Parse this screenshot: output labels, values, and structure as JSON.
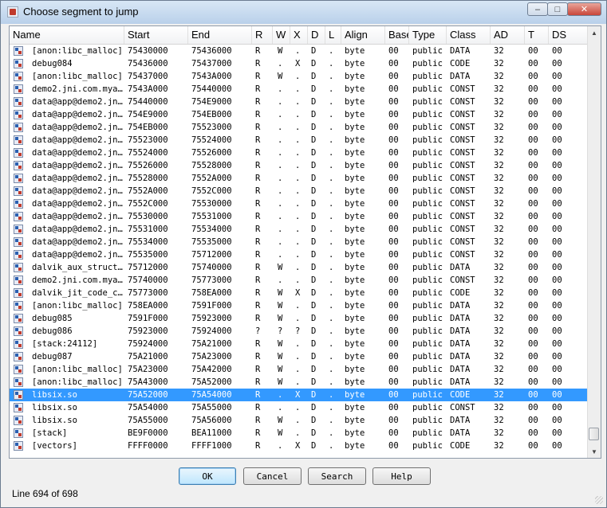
{
  "window": {
    "title": "Choose segment to jump"
  },
  "columns": [
    "Name",
    "Start",
    "End",
    "R",
    "W",
    "X",
    "D",
    "L",
    "Align",
    "Base",
    "Type",
    "Class",
    "AD",
    "T",
    "DS"
  ],
  "rows": [
    [
      "[anon:libc_malloc]",
      "75430000",
      "75436000",
      "R",
      "W",
      ".",
      "D",
      ".",
      "byte",
      "00",
      "public",
      "DATA",
      "32",
      "00",
      "00"
    ],
    [
      "debug084",
      "75436000",
      "75437000",
      "R",
      ".",
      "X",
      "D",
      ".",
      "byte",
      "00",
      "public",
      "CODE",
      "32",
      "00",
      "00"
    ],
    [
      "[anon:libc_malloc]",
      "75437000",
      "7543A000",
      "R",
      "W",
      ".",
      "D",
      ".",
      "byte",
      "00",
      "public",
      "DATA",
      "32",
      "00",
      "00"
    ],
    [
      "demo2.jni.com.mya…",
      "7543A000",
      "75440000",
      "R",
      ".",
      ".",
      "D",
      ".",
      "byte",
      "00",
      "public",
      "CONST",
      "32",
      "00",
      "00"
    ],
    [
      "data@app@demo2.jn…",
      "75440000",
      "754E9000",
      "R",
      ".",
      ".",
      "D",
      ".",
      "byte",
      "00",
      "public",
      "CONST",
      "32",
      "00",
      "00"
    ],
    [
      "data@app@demo2.jn…",
      "754E9000",
      "754EB000",
      "R",
      ".",
      ".",
      "D",
      ".",
      "byte",
      "00",
      "public",
      "CONST",
      "32",
      "00",
      "00"
    ],
    [
      "data@app@demo2.jn…",
      "754EB000",
      "75523000",
      "R",
      ".",
      ".",
      "D",
      ".",
      "byte",
      "00",
      "public",
      "CONST",
      "32",
      "00",
      "00"
    ],
    [
      "data@app@demo2.jn…",
      "75523000",
      "75524000",
      "R",
      ".",
      ".",
      "D",
      ".",
      "byte",
      "00",
      "public",
      "CONST",
      "32",
      "00",
      "00"
    ],
    [
      "data@app@demo2.jn…",
      "75524000",
      "75526000",
      "R",
      ".",
      ".",
      "D",
      ".",
      "byte",
      "00",
      "public",
      "CONST",
      "32",
      "00",
      "00"
    ],
    [
      "data@app@demo2.jn…",
      "75526000",
      "75528000",
      "R",
      ".",
      ".",
      "D",
      ".",
      "byte",
      "00",
      "public",
      "CONST",
      "32",
      "00",
      "00"
    ],
    [
      "data@app@demo2.jn…",
      "75528000",
      "7552A000",
      "R",
      ".",
      ".",
      "D",
      ".",
      "byte",
      "00",
      "public",
      "CONST",
      "32",
      "00",
      "00"
    ],
    [
      "data@app@demo2.jn…",
      "7552A000",
      "7552C000",
      "R",
      ".",
      ".",
      "D",
      ".",
      "byte",
      "00",
      "public",
      "CONST",
      "32",
      "00",
      "00"
    ],
    [
      "data@app@demo2.jn…",
      "7552C000",
      "75530000",
      "R",
      ".",
      ".",
      "D",
      ".",
      "byte",
      "00",
      "public",
      "CONST",
      "32",
      "00",
      "00"
    ],
    [
      "data@app@demo2.jn…",
      "75530000",
      "75531000",
      "R",
      ".",
      ".",
      "D",
      ".",
      "byte",
      "00",
      "public",
      "CONST",
      "32",
      "00",
      "00"
    ],
    [
      "data@app@demo2.jn…",
      "75531000",
      "75534000",
      "R",
      ".",
      ".",
      "D",
      ".",
      "byte",
      "00",
      "public",
      "CONST",
      "32",
      "00",
      "00"
    ],
    [
      "data@app@demo2.jn…",
      "75534000",
      "75535000",
      "R",
      ".",
      ".",
      "D",
      ".",
      "byte",
      "00",
      "public",
      "CONST",
      "32",
      "00",
      "00"
    ],
    [
      "data@app@demo2.jn…",
      "75535000",
      "75712000",
      "R",
      ".",
      ".",
      "D",
      ".",
      "byte",
      "00",
      "public",
      "CONST",
      "32",
      "00",
      "00"
    ],
    [
      "dalvik_aux_struct…",
      "75712000",
      "75740000",
      "R",
      "W",
      ".",
      "D",
      ".",
      "byte",
      "00",
      "public",
      "DATA",
      "32",
      "00",
      "00"
    ],
    [
      "demo2.jni.com.mya…",
      "75740000",
      "75773000",
      "R",
      ".",
      ".",
      "D",
      ".",
      "byte",
      "00",
      "public",
      "CONST",
      "32",
      "00",
      "00"
    ],
    [
      "dalvik_jit_code_c…",
      "75773000",
      "758EA000",
      "R",
      "W",
      "X",
      "D",
      ".",
      "byte",
      "00",
      "public",
      "CODE",
      "32",
      "00",
      "00"
    ],
    [
      "[anon:libc_malloc]",
      "758EA000",
      "7591F000",
      "R",
      "W",
      ".",
      "D",
      ".",
      "byte",
      "00",
      "public",
      "DATA",
      "32",
      "00",
      "00"
    ],
    [
      "debug085",
      "7591F000",
      "75923000",
      "R",
      "W",
      ".",
      "D",
      ".",
      "byte",
      "00",
      "public",
      "DATA",
      "32",
      "00",
      "00"
    ],
    [
      "debug086",
      "75923000",
      "75924000",
      "?",
      "?",
      "?",
      "D",
      ".",
      "byte",
      "00",
      "public",
      "DATA",
      "32",
      "00",
      "00"
    ],
    [
      "[stack:24112]",
      "75924000",
      "75A21000",
      "R",
      "W",
      ".",
      "D",
      ".",
      "byte",
      "00",
      "public",
      "DATA",
      "32",
      "00",
      "00"
    ],
    [
      "debug087",
      "75A21000",
      "75A23000",
      "R",
      "W",
      ".",
      "D",
      ".",
      "byte",
      "00",
      "public",
      "DATA",
      "32",
      "00",
      "00"
    ],
    [
      "[anon:libc_malloc]",
      "75A23000",
      "75A42000",
      "R",
      "W",
      ".",
      "D",
      ".",
      "byte",
      "00",
      "public",
      "DATA",
      "32",
      "00",
      "00"
    ],
    [
      "[anon:libc_malloc]",
      "75A43000",
      "75A52000",
      "R",
      "W",
      ".",
      "D",
      ".",
      "byte",
      "00",
      "public",
      "DATA",
      "32",
      "00",
      "00"
    ],
    [
      "libsix.so",
      "75A52000",
      "75A54000",
      "R",
      ".",
      "X",
      "D",
      ".",
      "byte",
      "00",
      "public",
      "CODE",
      "32",
      "00",
      "00"
    ],
    [
      "libsix.so",
      "75A54000",
      "75A55000",
      "R",
      ".",
      ".",
      "D",
      ".",
      "byte",
      "00",
      "public",
      "CONST",
      "32",
      "00",
      "00"
    ],
    [
      "libsix.so",
      "75A55000",
      "75A56000",
      "R",
      "W",
      ".",
      "D",
      ".",
      "byte",
      "00",
      "public",
      "DATA",
      "32",
      "00",
      "00"
    ],
    [
      "[stack]",
      "BE9F0000",
      "BEA11000",
      "R",
      "W",
      ".",
      "D",
      ".",
      "byte",
      "00",
      "public",
      "DATA",
      "32",
      "00",
      "00"
    ],
    [
      "[vectors]",
      "FFFF0000",
      "FFFF1000",
      "R",
      ".",
      "X",
      "D",
      ".",
      "byte",
      "00",
      "public",
      "CODE",
      "32",
      "00",
      "00"
    ]
  ],
  "selected_row": 27,
  "buttons": {
    "ok": "OK",
    "cancel": "Cancel",
    "search": "Search",
    "help": "Help"
  },
  "status": "Line 694 of 698",
  "colors": {
    "selection": "#3399ff"
  }
}
